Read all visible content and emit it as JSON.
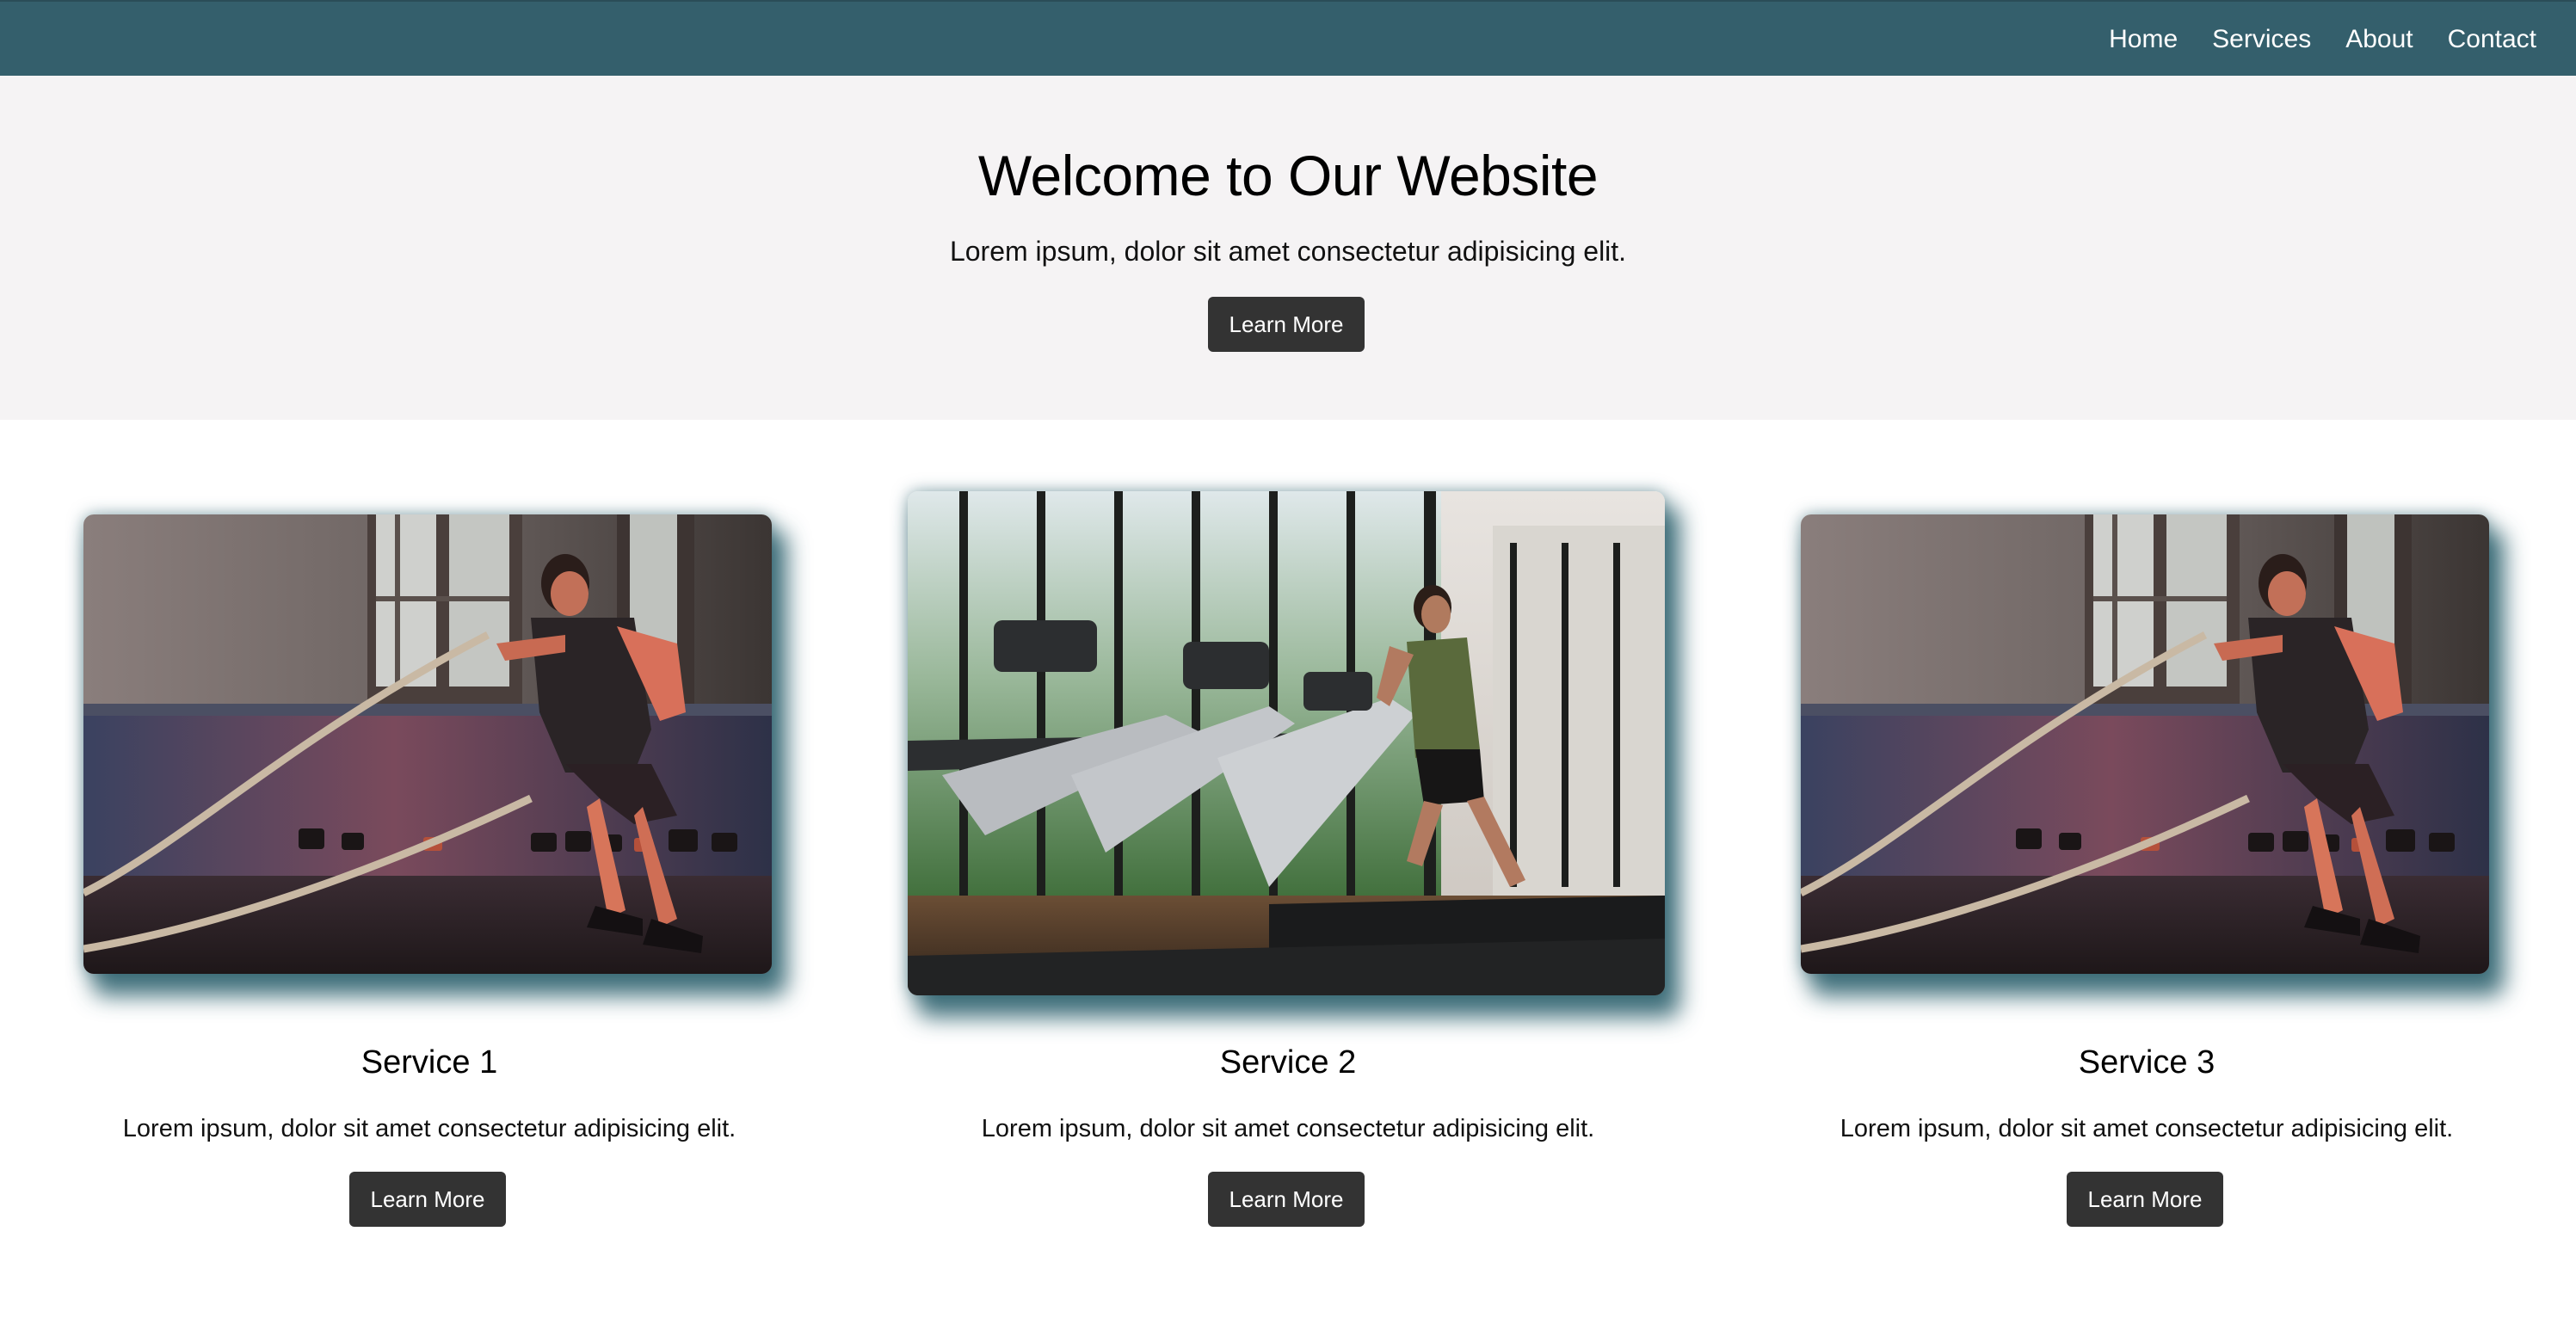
{
  "nav": {
    "links": [
      "Home",
      "Services",
      "About",
      "Contact"
    ]
  },
  "hero": {
    "title": "Welcome to Our Website",
    "subtitle": "Lorem ipsum, dolor sit amet consectetur adipisicing elit.",
    "button_label": "Learn More"
  },
  "services": [
    {
      "title": "Service 1",
      "text": "Lorem ipsum, dolor sit amet consectetur adipisicing elit.",
      "button_label": "Learn More",
      "image": "battle-ropes-workout-photo"
    },
    {
      "title": "Service 2",
      "text": "Lorem ipsum, dolor sit amet consectetur adipisicing elit.",
      "button_label": "Learn More",
      "image": "treadmill-gym-photo"
    },
    {
      "title": "Service 3",
      "text": "Lorem ipsum, dolor sit amet consectetur adipisicing elit.",
      "button_label": "Learn More",
      "image": "battle-ropes-workout-photo"
    }
  ],
  "colors": {
    "navbar": "#345f6c",
    "hero_bg": "#f5f3f4",
    "button_bg": "#333333",
    "card_shadow": "#265c68"
  }
}
